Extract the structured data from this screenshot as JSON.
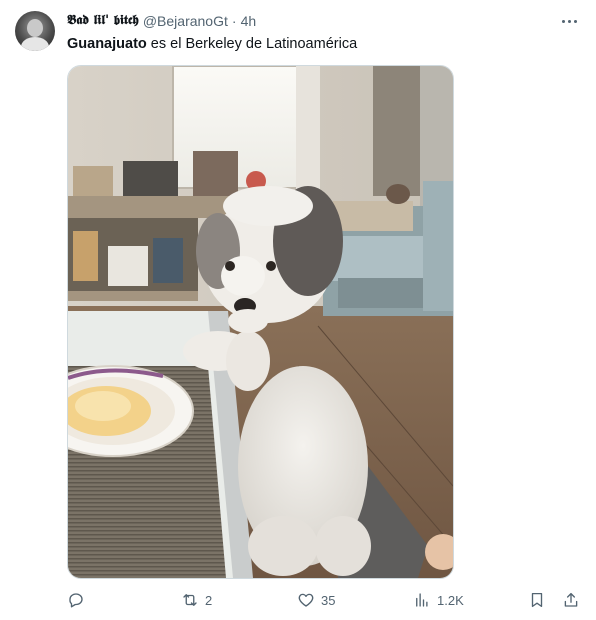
{
  "tweet": {
    "display_name": "𝕭𝖆𝖉 𝖑𝖎𝖑' 𝖇𝖎𝖙𝖈𝖍",
    "handle": "@BejaranoGt",
    "separator": "·",
    "time": "4h",
    "text_bold": "Guanajuato",
    "text_rest": " es el Berkeley de Latinoamérica"
  },
  "actions": {
    "reply_count": "",
    "retweet_count": "2",
    "like_count": "35",
    "views_count": "1.2K"
  },
  "icons": {
    "more": "more-horizontal-icon",
    "reply": "reply-icon",
    "retweet": "retweet-icon",
    "like": "heart-icon",
    "views": "views-chart-icon",
    "bookmark": "bookmark-icon",
    "share": "share-icon"
  },
  "colors": {
    "text": "#0f1419",
    "secondary": "#536471",
    "border": "#cfd9de"
  }
}
